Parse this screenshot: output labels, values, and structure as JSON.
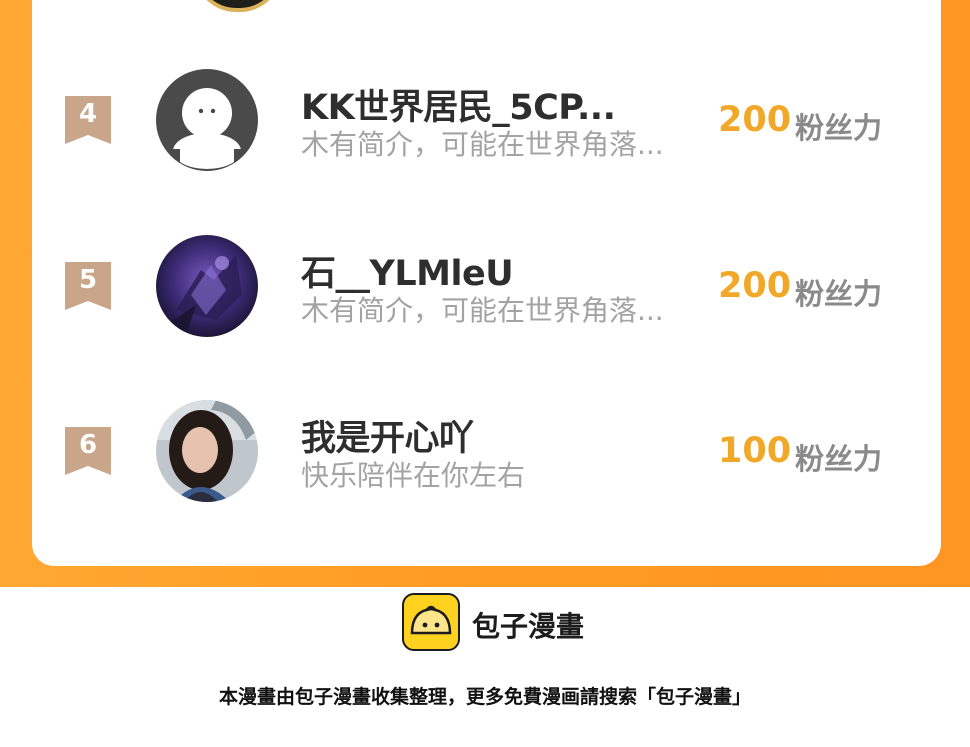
{
  "leaderboard": {
    "entries": [
      {
        "rank": "4",
        "name": "KK世界居民_5CP...",
        "bio": "木有简介，可能在世界角落...",
        "score": "200",
        "score_unit": "粉丝力",
        "avatar": "default-avatar-icon"
      },
      {
        "rank": "5",
        "name": "石__YLMleU",
        "bio": "木有简介，可能在世界角落...",
        "score": "200",
        "score_unit": "粉丝力",
        "avatar": "dark-fantasy-avatar"
      },
      {
        "rank": "6",
        "name": "我是开心吖",
        "bio": "快乐陪伴在你左右",
        "score": "100",
        "score_unit": "粉丝力",
        "avatar": "photo-avatar"
      }
    ]
  },
  "footer": {
    "brand_name": "包子漫畫",
    "note": "本漫畫由包子漫畫收集整理，更多免費漫画請搜索「包子漫畫」"
  },
  "colors": {
    "accent_orange": "#ff9b22",
    "score_gold": "#f1a829",
    "rank_flag": "#c9a589",
    "logo_yellow": "#ffd21f"
  }
}
